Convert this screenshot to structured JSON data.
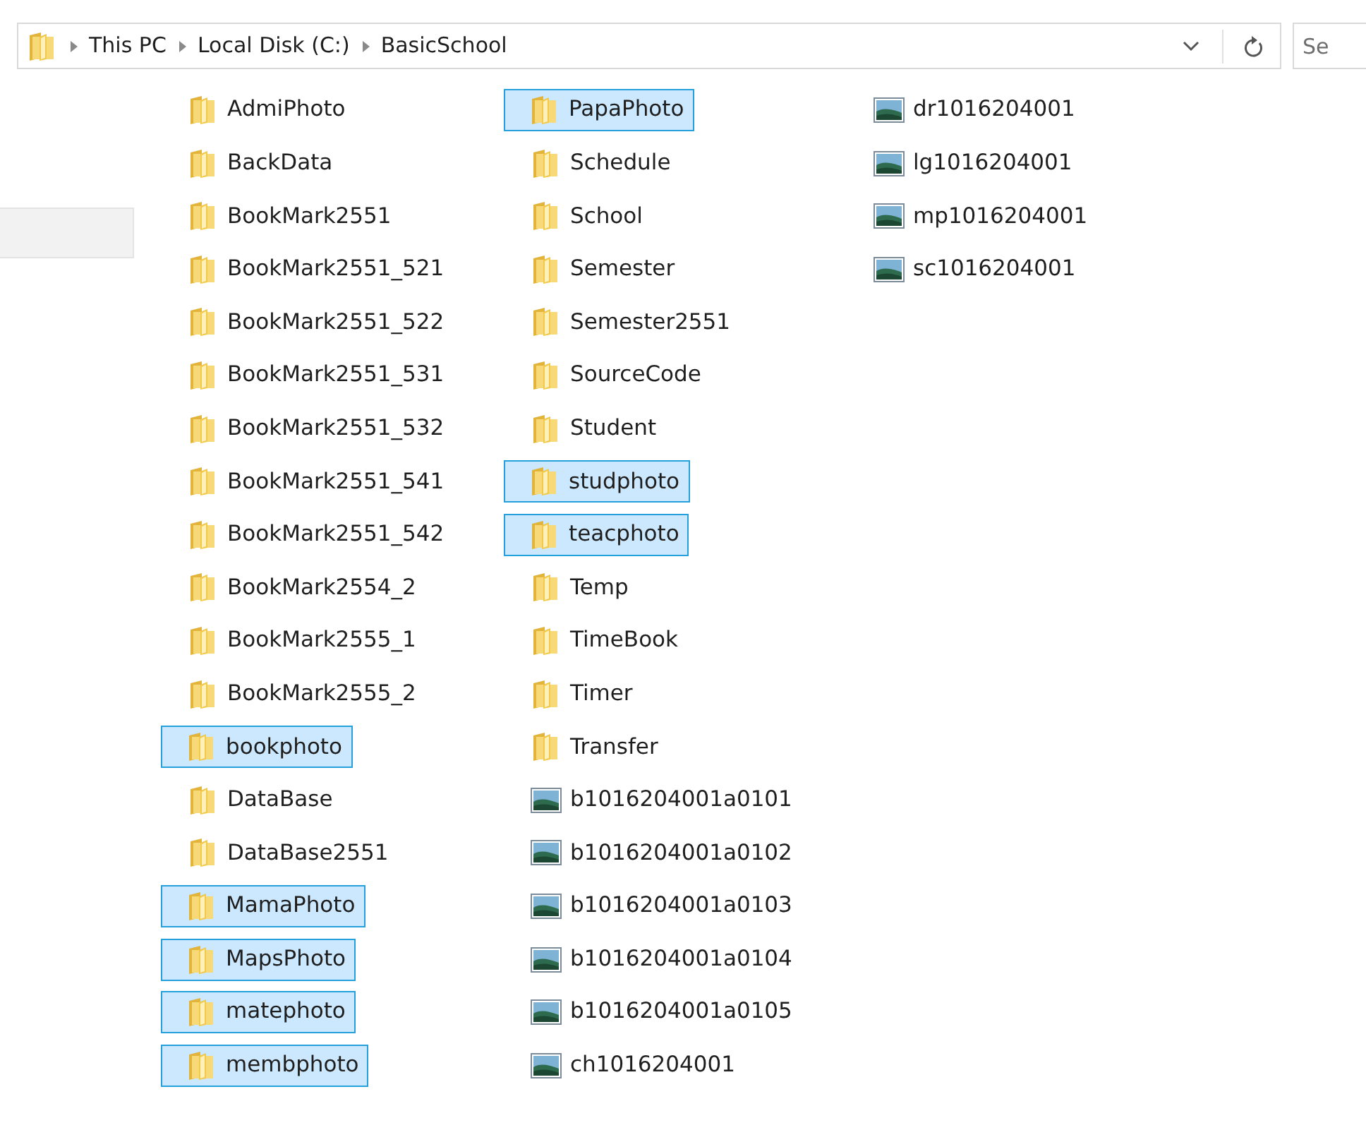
{
  "address_bar": {
    "path": [
      "This PC",
      "Local Disk (C:)",
      "BasicSchool"
    ]
  },
  "search": {
    "placeholder": "Se"
  },
  "files": [
    {
      "name": "AdmiPhoto",
      "kind": "folder",
      "selected": false
    },
    {
      "name": "BackData",
      "kind": "folder",
      "selected": false
    },
    {
      "name": "BookMark2551",
      "kind": "folder",
      "selected": false
    },
    {
      "name": "BookMark2551_521",
      "kind": "folder",
      "selected": false
    },
    {
      "name": "BookMark2551_522",
      "kind": "folder",
      "selected": false
    },
    {
      "name": "BookMark2551_531",
      "kind": "folder",
      "selected": false
    },
    {
      "name": "BookMark2551_532",
      "kind": "folder",
      "selected": false
    },
    {
      "name": "BookMark2551_541",
      "kind": "folder",
      "selected": false
    },
    {
      "name": "BookMark2551_542",
      "kind": "folder",
      "selected": false
    },
    {
      "name": "BookMark2554_2",
      "kind": "folder",
      "selected": false
    },
    {
      "name": "BookMark2555_1",
      "kind": "folder",
      "selected": false
    },
    {
      "name": "BookMark2555_2",
      "kind": "folder",
      "selected": false
    },
    {
      "name": "bookphoto",
      "kind": "folder",
      "selected": true
    },
    {
      "name": "DataBase",
      "kind": "folder",
      "selected": false
    },
    {
      "name": "DataBase2551",
      "kind": "folder",
      "selected": false
    },
    {
      "name": "MamaPhoto",
      "kind": "folder",
      "selected": true
    },
    {
      "name": "MapsPhoto",
      "kind": "folder",
      "selected": true
    },
    {
      "name": "matephoto",
      "kind": "folder",
      "selected": true
    },
    {
      "name": "membphoto",
      "kind": "folder",
      "selected": true
    },
    {
      "name": "PapaPhoto",
      "kind": "folder",
      "selected": true
    },
    {
      "name": "Schedule",
      "kind": "folder",
      "selected": false
    },
    {
      "name": "School",
      "kind": "folder",
      "selected": false
    },
    {
      "name": "Semester",
      "kind": "folder",
      "selected": false
    },
    {
      "name": "Semester2551",
      "kind": "folder",
      "selected": false
    },
    {
      "name": "SourceCode",
      "kind": "folder",
      "selected": false
    },
    {
      "name": "Student",
      "kind": "folder",
      "selected": false
    },
    {
      "name": "studphoto",
      "kind": "folder",
      "selected": true
    },
    {
      "name": "teacphoto",
      "kind": "folder",
      "selected": true
    },
    {
      "name": "Temp",
      "kind": "folder",
      "selected": false
    },
    {
      "name": "TimeBook",
      "kind": "folder",
      "selected": false
    },
    {
      "name": "Timer",
      "kind": "folder",
      "selected": false
    },
    {
      "name": "Transfer",
      "kind": "folder",
      "selected": false
    },
    {
      "name": "b1016204001a0101",
      "kind": "image",
      "selected": false
    },
    {
      "name": "b1016204001a0102",
      "kind": "image",
      "selected": false
    },
    {
      "name": "b1016204001a0103",
      "kind": "image",
      "selected": false
    },
    {
      "name": "b1016204001a0104",
      "kind": "image",
      "selected": false
    },
    {
      "name": "b1016204001a0105",
      "kind": "image",
      "selected": false
    },
    {
      "name": "ch1016204001",
      "kind": "image",
      "selected": false
    },
    {
      "name": "dr1016204001",
      "kind": "image",
      "selected": false
    },
    {
      "name": "lg1016204001",
      "kind": "image",
      "selected": false
    },
    {
      "name": "mp1016204001",
      "kind": "image",
      "selected": false
    },
    {
      "name": "sc1016204001",
      "kind": "image",
      "selected": false
    }
  ]
}
